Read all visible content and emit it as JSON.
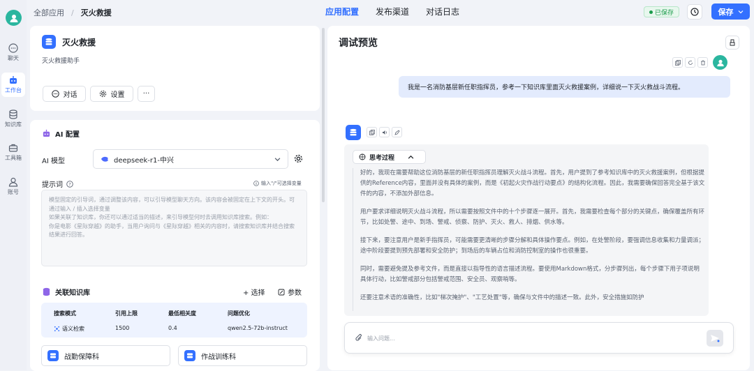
{
  "sidebar": {
    "items": [
      {
        "label": "聊天",
        "icon": "chat-icon"
      },
      {
        "label": "工作台",
        "icon": "robot-icon",
        "active": true
      },
      {
        "label": "知识库",
        "icon": "database-icon"
      },
      {
        "label": "工具箱",
        "icon": "toolbox-icon"
      },
      {
        "label": "账号",
        "icon": "user-icon"
      }
    ]
  },
  "breadcrumb": {
    "root": "全部应用",
    "current": "灭火救援"
  },
  "tabs": [
    "应用配置",
    "发布渠道",
    "对话日志"
  ],
  "status": {
    "saved": "已保存"
  },
  "save_label": "保存",
  "app": {
    "name": "灭火救援",
    "desc": "灭火救援助手",
    "chat_btn": "对话",
    "settings_btn": "设置",
    "more": "···"
  },
  "ai_config": {
    "title": "AI 配置",
    "model_label": "AI 模型",
    "model_value": "deepseek-r1-中兴",
    "prompt_label": "提示词",
    "prompt_hint": "输入\"/\"可选择变量",
    "prompt_placeholder": "模型固定的引导词，通过调整该内容，可以引导模型聊天方向。该内容会被固定在上下文的开头。可通过输入 / 插入选择变量\n如果关联了知识库，你还可以通过适当的描述，来引导模型何时去调用知识库搜索。例如：\n你是电影《星际穿越》的助手，当用户询问与《星际穿越》相关的内容时，请搜索知识库并结合搜索结果进行回答。"
  },
  "kb": {
    "title": "关联知识库",
    "select_btn": "+ 选择",
    "param_btn": "参数",
    "headers": [
      "搜索模式",
      "引用上限",
      "最低相关度",
      "问题优化"
    ],
    "row": [
      "语义检索",
      "1500",
      "0.4",
      "qwen2.5-72b-instruct"
    ],
    "items": [
      "战勤保障科",
      "作战训练科"
    ]
  },
  "preview": {
    "title": "调试预览",
    "user_message": "我是一名消防基层新任职指挥员，参考一下知识库里面灭火救援案例，详细说一下灭火救战斗流程。",
    "think_label": "思考过程",
    "paragraphs": [
      "好的，我现在需要帮助这位消防基层的新任职指挥员理解灭火战斗流程。首先，用户提到了参考知识库中的灭火救援案例，但根据提供的Reference内容，里面并没有具体的案例，而是《初起火灾作战行动要点》的结构化流程。因此，我需要确保回答完全基于该文件的内容，不添加外部信息。",
      "用户要求详细说明灭火战斗流程，所以需要按照文件中的十个步骤逐一展开。首先，我需要检查每个部分的关键点，确保覆盖所有环节，比如处警、途中、到场、警戒、侦察、防护、灭火、救人、排烟、供水等。",
      "接下来，要注意用户是新手指挥员，可能需要更清晰的步骤分解和具体操作要点。例如，在处警阶段，要强调信息收集和力量调派；途中阶段要提到预先部署和安全防护；到场后的车辆占位和消防控制室的操作也很重要。",
      "同时，需要避免提及参考文件，而是直接以指导性的语言描述流程。要使用Markdown格式，分步骤列出，每个步骤下用子项说明具体行动，比如警戒部分包括警戒范围、安全员、观察哨等。",
      "还要注意术语的准确性，比如\"梯次掩护\"、\"工艺处置\"等，确保与文件中的描述一致。此外，安全措施如防护"
    ],
    "input_placeholder": "输入问题..."
  },
  "colors": {
    "accent": "#3370ff",
    "success": "#1a9b4b",
    "avatar": "#2bb69f"
  }
}
